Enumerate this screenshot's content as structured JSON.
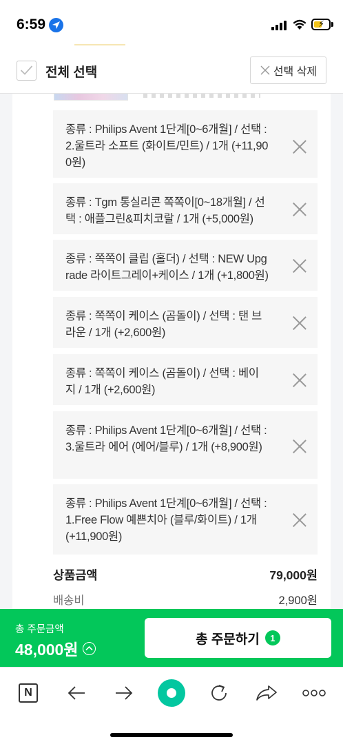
{
  "status_bar": {
    "time": "6:59"
  },
  "header": {
    "select_all_label": "전체 선택",
    "delete_selected_label": "선택 삭제"
  },
  "options": [
    {
      "text": "종류 : Philips Avent 1단계[0~6개월] / 선택 : 2.울트라 소프트 (화이트/민트) / 1개 (+11,900원)"
    },
    {
      "text": "종류 : Tgm 통실리콘 쪽쪽이[0~18개월] / 선택 : 애플그린&피치코랄 / 1개 (+5,000원)"
    },
    {
      "text": "종류 : 쪽쪽이 클립 (홀더) / 선택 : NEW Upgrade 라이트그레이+케이스 / 1개 (+1,800원)"
    },
    {
      "text": "종류 : 쪽쪽이 케이스 (곰돌이) / 선택 : 탠 브라운 / 1개 (+2,600원)"
    },
    {
      "text": "종류 : 쪽쪽이 케이스 (곰돌이) / 선택 : 베이지 / 1개 (+2,600원)"
    },
    {
      "text": "종류 : Philips Avent 1단계[0~6개월] / 선택 : 3.울트라 에어 (에어/블루) / 1개 (+8,900원)"
    },
    {
      "text": "종류 : Philips Avent 1단계[0~6개월] / 선택 : 1.Free Flow 예쁜치아 (블루/화이트) / 1개 (+11,900원)"
    }
  ],
  "summary": {
    "product_amount_label": "상품금액",
    "product_amount_value": "79,000원",
    "shipping_label": "배송비",
    "shipping_value": "2,900원"
  },
  "order_bar": {
    "total_label": "총 주문금액",
    "total_amount": "48,000원",
    "order_button_label": "총 주문하기",
    "order_count": "1"
  },
  "toolbar": {
    "naver_label": "N",
    "icons": [
      "naver-icon",
      "back-arrow-icon",
      "forward-arrow-icon",
      "home-circle-icon",
      "refresh-icon",
      "share-icon",
      "more-icon"
    ]
  },
  "colors": {
    "accent_green": "#03c75a",
    "home_button": "#03c7a0"
  }
}
